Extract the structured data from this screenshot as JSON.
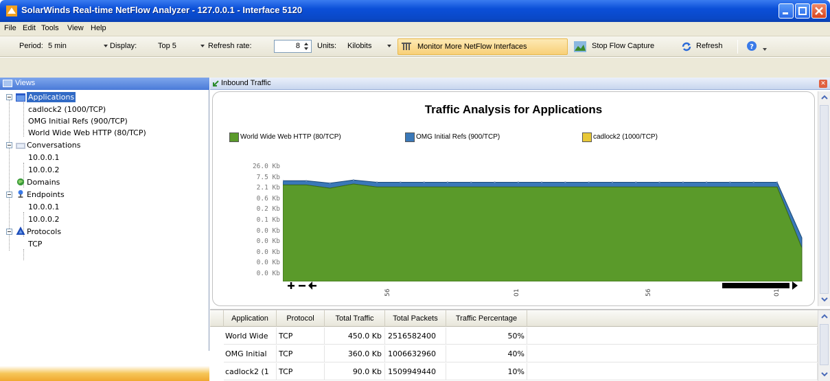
{
  "window": {
    "title": "SolarWinds Real-time NetFlow Analyzer - 127.0.0.1 - Interface 5120"
  },
  "menu": {
    "items": [
      "File",
      "Edit",
      "Tools",
      "View",
      "Help"
    ]
  },
  "toolbar": {
    "period_label": "Period:",
    "period_value": "5 min",
    "display_label": "Display:",
    "display_value": "Top 5",
    "refresh_rate_label": "Refresh rate:",
    "refresh_rate_value": "8",
    "units_label": "Units:",
    "units_value": "Kilobits",
    "monitor_label": "Monitor More NetFlow Interfaces",
    "stop_label": "Stop Flow Capture",
    "refresh_label": "Refresh"
  },
  "views": {
    "header": "Views",
    "tree": {
      "applications": {
        "label": "Applications",
        "children": [
          "cadlock2 (1000/TCP)",
          "OMG Initial Refs (900/TCP)",
          "World Wide Web HTTP (80/TCP)"
        ]
      },
      "conversations": {
        "label": "Conversations",
        "children": [
          "10.0.0.1",
          "10.0.0.2"
        ]
      },
      "domains": {
        "label": "Domains"
      },
      "endpoints": {
        "label": "Endpoints",
        "children": [
          "10.0.0.1",
          "10.0.0.2"
        ]
      },
      "protocols": {
        "label": "Protocols",
        "children": [
          "TCP"
        ]
      }
    }
  },
  "panel": {
    "title": "Inbound Traffic"
  },
  "chart_data": {
    "type": "area",
    "title": "Traffic Analysis for Applications",
    "legend": [
      "World Wide Web HTTP (80/TCP)",
      "OMG Initial Refs (900/TCP)",
      "cadlock2 (1000/TCP)"
    ],
    "y_ticks": [
      "26.0 Kb",
      "7.5 Kb",
      "2.1 Kb",
      "0.6 Kb",
      "0.2 Kb",
      "0.1 Kb",
      "0.0 Kb",
      "0.0 Kb",
      "0.0 Kb",
      "0.0 Kb",
      "0.0 Kb"
    ],
    "x_ticks": [
      "56",
      "01",
      "56",
      "01"
    ],
    "colors": {
      "www": "#5a9a2a",
      "omg": "#3a78b8",
      "cad": "#e8c838"
    },
    "series": [
      {
        "name": "World Wide Web HTTP (80/TCP)",
        "values": [
          7.5,
          7.5,
          6.0,
          8.0,
          6.5,
          6.5,
          6.5,
          6.5,
          6.5,
          6.5,
          6.5,
          6.5,
          6.5,
          6.5,
          6.5,
          6.5,
          6.5,
          6.5,
          6.5,
          6.5,
          6.5,
          6.5,
          0.1
        ]
      },
      {
        "name": "OMG Initial Refs (900/TCP)",
        "values": [
          2.5,
          2.5,
          2.5,
          2.5,
          2.5,
          2.5,
          2.5,
          2.5,
          2.5,
          2.5,
          2.5,
          2.5,
          2.5,
          2.5,
          2.5,
          2.5,
          2.5,
          2.5,
          2.5,
          2.5,
          2.5,
          2.5,
          0.1
        ]
      }
    ]
  },
  "table": {
    "columns": [
      "Application",
      "Protocol",
      "Total Traffic",
      "Total Packets",
      "Traffic Percentage"
    ],
    "rows": [
      [
        "World Wide",
        "TCP",
        "450.0 Kb",
        "2516582400",
        "50%"
      ],
      [
        "OMG Initial",
        "TCP",
        "360.0 Kb",
        "1006632960",
        "40%"
      ],
      [
        "cadlock2 (1",
        "TCP",
        "90.0 Kb",
        "1509949440",
        "10%"
      ]
    ]
  }
}
